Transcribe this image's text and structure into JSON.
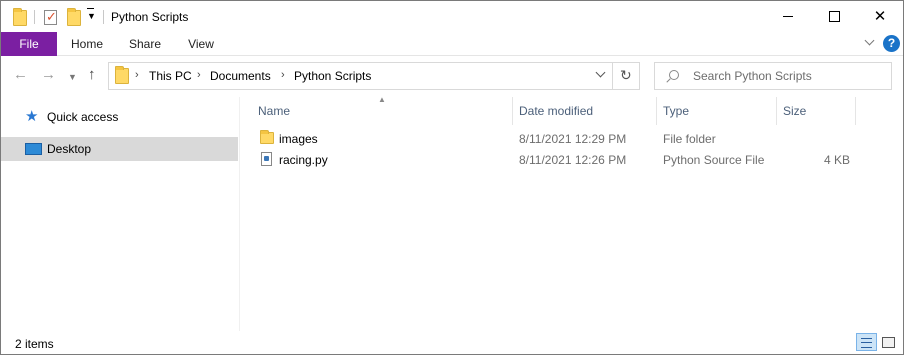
{
  "window": {
    "title": "Python Scripts",
    "minimize_icon": "minimize-icon",
    "maximize_icon": "maximize-icon",
    "close_glyph": "✕"
  },
  "ribbon": {
    "tabs": [
      {
        "label": "File",
        "active": true,
        "accent": "#7b1fa2"
      },
      {
        "label": "Home"
      },
      {
        "label": "Share"
      },
      {
        "label": "View"
      }
    ],
    "help_label": "?"
  },
  "navigation": {
    "back_glyph": "←",
    "forward_glyph": "→",
    "recent_glyph": "⌄",
    "up_glyph": "↑",
    "breadcrumb": [
      "This PC",
      "Documents",
      "Python Scripts"
    ],
    "breadcrumb_sep": "›",
    "refresh_glyph": "↻",
    "search_placeholder": "Search Python Scripts"
  },
  "sidebar": {
    "items": [
      {
        "label": "Quick access",
        "icon": "star-icon"
      },
      {
        "label": "Desktop",
        "icon": "desktop-icon",
        "selected": true
      }
    ]
  },
  "files": {
    "columns": [
      "Name",
      "Date modified",
      "Type",
      "Size"
    ],
    "rows": [
      {
        "name": "images",
        "date": "8/11/2021 12:29 PM",
        "type": "File folder",
        "size": "",
        "icon": "folder-icon"
      },
      {
        "name": "racing.py",
        "date": "8/11/2021 12:26 PM",
        "type": "Python Source File",
        "size": "4 KB",
        "icon": "python-file-icon"
      }
    ]
  },
  "status": {
    "item_count": "2 items"
  },
  "colors": {
    "file_tab": "#7b1fa2",
    "selection": "#d9d9d9",
    "header_text": "#4c607a",
    "help": "#1a73c8"
  }
}
